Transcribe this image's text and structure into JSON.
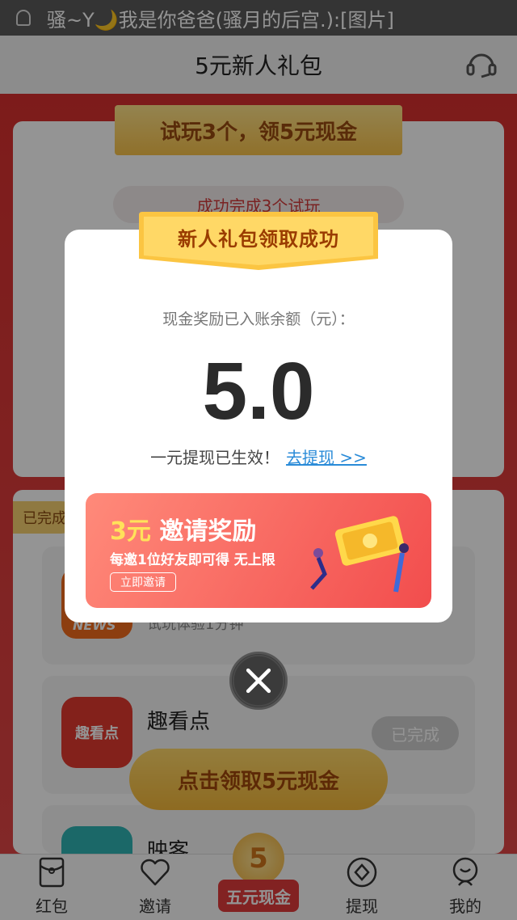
{
  "status_bar": {
    "notification_text": "骚~Y🌙我是你爸爸(骚月的后宫.):[图片]"
  },
  "nav": {
    "title": "5元新人礼包",
    "support_icon": "headset-icon"
  },
  "card1": {
    "ribbon": "试玩3个，领5元现金",
    "progress": "成功完成3个试玩"
  },
  "card2": {
    "tag": "已完成",
    "tasks": [
      {
        "subtitle": "试玩体验1分钟",
        "icon_text": "NEWS"
      },
      {
        "title": "趣看点",
        "icon_text": "趣看点",
        "status": "已完成"
      },
      {
        "title": "映客"
      }
    ]
  },
  "claim_button": "点击领取5元现金",
  "tabs": [
    {
      "label": "红包",
      "icon": "red-envelope-icon"
    },
    {
      "label": "邀请",
      "icon": "heart-icon"
    },
    {
      "label": "五元现金",
      "coin": "5"
    },
    {
      "label": "提现",
      "icon": "withdraw-icon"
    },
    {
      "label": "我的",
      "icon": "profile-icon"
    }
  ],
  "dialog": {
    "ribbon": "新人礼包领取成功",
    "subtitle": "现金奖励已入账余额（元）：",
    "amount": "5.0",
    "withdraw_text": "一元提现已生效！",
    "withdraw_link": "去提现 >>",
    "invite": {
      "amount": "3元",
      "title": "邀请奖励",
      "subtitle": "每邀1位好友即可得 无上限",
      "button": "立即邀请"
    },
    "close_icon": "close-icon"
  },
  "colors": {
    "accent_red": "#e03b3b",
    "gold": "#f4b83a",
    "link_blue": "#2a8bd8"
  }
}
